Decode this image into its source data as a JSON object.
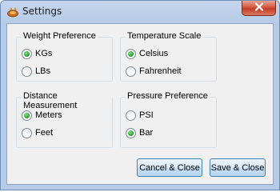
{
  "window": {
    "title": "Settings",
    "icon": "app-icon",
    "close_icon": "close-icon"
  },
  "groups": {
    "weight": {
      "title": "Weight Preference",
      "options": [
        {
          "label": "KGs",
          "selected": true
        },
        {
          "label": "LBs",
          "selected": false
        }
      ]
    },
    "temperature": {
      "title": "Temperature Scale",
      "options": [
        {
          "label": "Celsius",
          "selected": true
        },
        {
          "label": "Fahrenheit",
          "selected": false
        }
      ]
    },
    "distance": {
      "title": "Distance Measurement",
      "options": [
        {
          "label": "Meters",
          "selected": true
        },
        {
          "label": "Feet",
          "selected": false
        }
      ]
    },
    "pressure": {
      "title": "Pressure Preference",
      "options": [
        {
          "label": "PSI",
          "selected": false
        },
        {
          "label": "Bar",
          "selected": true
        }
      ]
    }
  },
  "buttons": {
    "cancel_label": "Cancel & Close",
    "save_label": "Save & Close"
  },
  "colors": {
    "radio_selected": "#2da12b",
    "button_border": "#3c7fb1",
    "close_button": "#c43c25"
  }
}
